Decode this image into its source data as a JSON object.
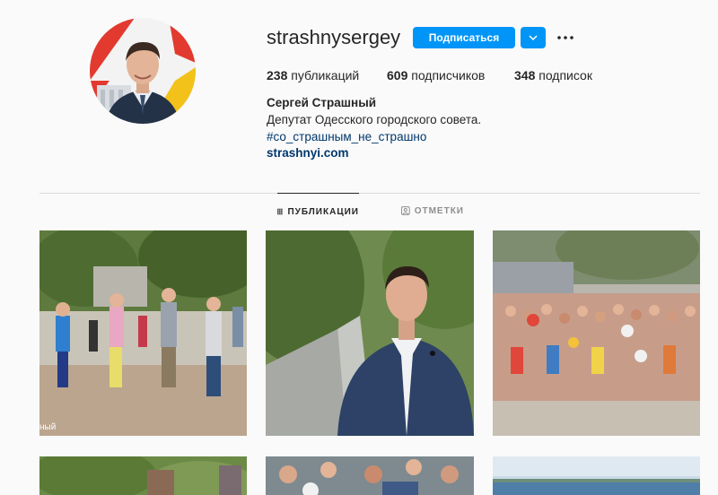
{
  "profile": {
    "username": "strashnysergey",
    "follow_label": "Подписаться",
    "full_name": "Сергей Страшный",
    "bio": "Депутат Одесского городского совета.",
    "hashtag": "#со_страшным_не_страшно",
    "website": "strashnyi.com"
  },
  "stats": {
    "posts_count": "238",
    "posts_label": "публикаций",
    "followers_count": "609",
    "followers_label": "подписчиков",
    "following_count": "348",
    "following_label": "подписок"
  },
  "tabs": {
    "posts": "ПУБЛИКАЦИИ",
    "tagged": "ОТМЕТКИ"
  },
  "posts": {
    "first_caption": "ный"
  },
  "colors": {
    "accent": "#0095f6",
    "link": "#00376b",
    "background": "#fafafa",
    "text": "#262626",
    "muted": "#8e8e8e"
  },
  "icons": [
    "chevron-down-icon",
    "more-icon",
    "grid-icon",
    "tagged-icon"
  ]
}
